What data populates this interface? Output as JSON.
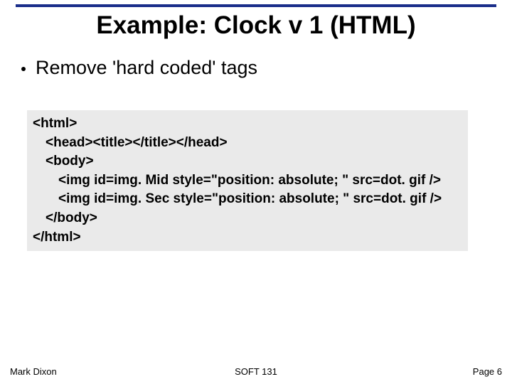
{
  "title": "Example: Clock v 1 (HTML)",
  "bullet": "Remove 'hard coded' tags",
  "code": {
    "l1": "<html>",
    "l2": "<head><title></title></head>",
    "l3": "<body>",
    "l4": "<img id=img. Mid style=\"position: absolute; \" src=dot. gif />",
    "l5": "<img id=img. Sec style=\"position: absolute; \" src=dot. gif />",
    "l6": "</body>",
    "l7": "</html>"
  },
  "footer": {
    "left": "Mark Dixon",
    "center": "SOFT 131",
    "right": "Page 6"
  }
}
